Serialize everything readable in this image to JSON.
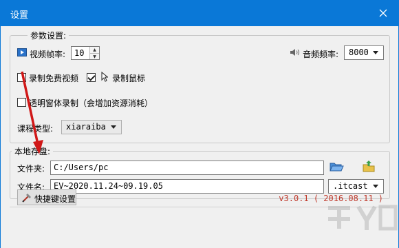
{
  "window": {
    "title": "设置"
  },
  "params": {
    "group_title": "参数设置:",
    "fps_label": "视频帧率:",
    "fps_value": "10",
    "audio_label": "音频频率:",
    "audio_value": "8000",
    "record_free_video": {
      "label": "录制免费视频",
      "checked": false
    },
    "record_mouse": {
      "label": "录制鼠标",
      "checked": true
    },
    "transparent_window": {
      "label": "透明窗体录制（会增加资源消耗）",
      "checked": false
    },
    "course_type_label": "课程类型:",
    "course_type_value": "xiaraiba"
  },
  "storage": {
    "group_title": "本地存盘:",
    "folder_label": "文件夹:",
    "folder_value": "C:/Users/pc",
    "filename_label": "文件名:",
    "filename_value": "EV~2020.11.24~09.19.05",
    "ext_value": ".itcast"
  },
  "footer": {
    "shortcut_label": "快捷键设置",
    "version": "v3.0.1 ( 2016.08.11 )"
  },
  "colors": {
    "titlebar": "#0a78d7",
    "annotation_arrow": "#d01818",
    "version_text": "#c0392b"
  },
  "icons": [
    "close-icon",
    "video-icon",
    "speaker-icon",
    "cursor-icon",
    "folder-open-icon",
    "folder-up-icon",
    "tools-icon"
  ]
}
